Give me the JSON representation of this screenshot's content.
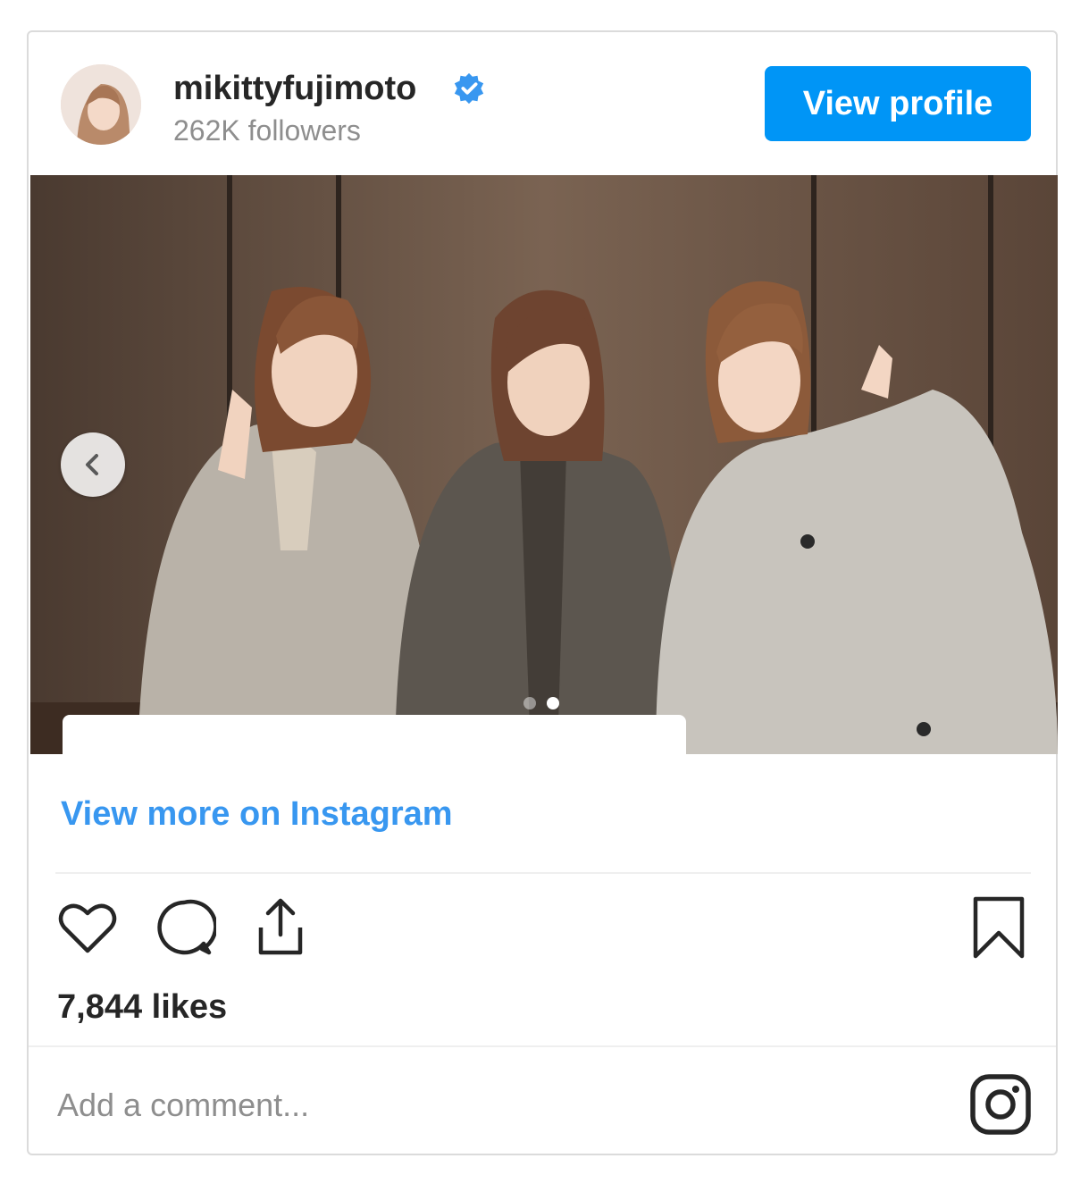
{
  "header": {
    "username": "mikittyfujimoto",
    "followers": "262K followers",
    "view_profile_label": "View profile",
    "verified_color": "#3897f0"
  },
  "post": {
    "carousel": {
      "current_slide": 2,
      "total_slides": 2
    },
    "view_more_label": "View more on Instagram",
    "likes": "7,844 likes",
    "comment_placeholder": "Add a comment..."
  },
  "icons": [
    "heart-icon",
    "comment-icon",
    "share-icon",
    "bookmark-icon",
    "instagram-icon",
    "chevron-left-icon",
    "verified-badge-icon"
  ],
  "colors": {
    "accent": "#0095f6",
    "link": "#3897f0",
    "text": "#262626",
    "muted": "#8e8e8e"
  }
}
